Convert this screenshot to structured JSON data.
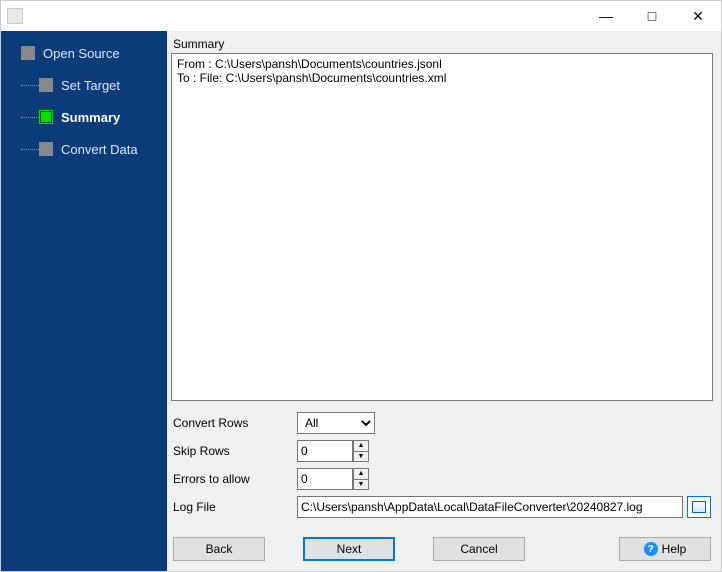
{
  "window": {
    "title": ""
  },
  "sidebar": {
    "items": [
      {
        "label": "Open Source",
        "active": false
      },
      {
        "label": "Set Target",
        "active": false
      },
      {
        "label": "Summary",
        "active": true
      },
      {
        "label": "Convert Data",
        "active": false
      }
    ]
  },
  "main": {
    "section_label": "Summary",
    "summary_text": "From : C:\\Users\\pansh\\Documents\\countries.jsonl\nTo : File: C:\\Users\\pansh\\Documents\\countries.xml",
    "options": {
      "convert_rows": {
        "label": "Convert Rows",
        "value": "All"
      },
      "skip_rows": {
        "label": "Skip Rows",
        "value": "0"
      },
      "errors_allow": {
        "label": "Errors to allow",
        "value": "0"
      },
      "log_file": {
        "label": "Log File",
        "value": "C:\\Users\\pansh\\AppData\\Local\\DataFileConverter\\20240827.log"
      }
    }
  },
  "buttons": {
    "back": "Back",
    "next": "Next",
    "cancel": "Cancel",
    "help": "Help"
  }
}
